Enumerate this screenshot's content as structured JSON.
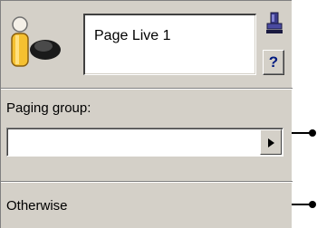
{
  "node": {
    "title": "Page Live 1",
    "help_label": "?",
    "paging_group": {
      "label": "Paging group:",
      "value": ""
    },
    "otherwise_label": "Otherwise"
  },
  "icons": {
    "person": "person-speaker-icon",
    "stamp": "stamp-icon",
    "dropdown": "chevron-right-icon",
    "connector": "output-connector-icon"
  },
  "colors": {
    "panel": "#d4d0c8",
    "help_text": "#001a80"
  }
}
